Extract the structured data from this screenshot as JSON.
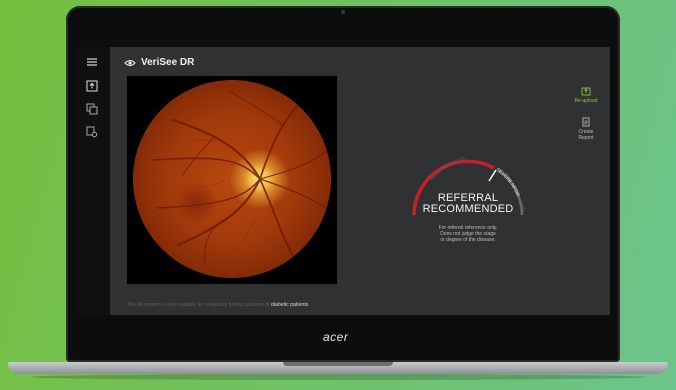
{
  "app": {
    "title": "VeriSee DR",
    "brand_logo": "acer"
  },
  "sidebar": {
    "items": [
      {
        "icon": "menu-icon"
      },
      {
        "icon": "upload-icon"
      },
      {
        "icon": "copy-icon"
      },
      {
        "icon": "report-settings-icon"
      }
    ]
  },
  "result": {
    "status_line1": "REFERRAL",
    "status_line2": "RECOMMENDED",
    "note_line1": "For referral reference only.",
    "note_line2": "Does not judge the stage",
    "note_line3": "or degree of the disease.",
    "gauge_labels": {
      "moderate": "MODERATE NPDR",
      "severe": "SEVERE NPDR",
      "pdr": "PDR"
    },
    "gauge_level": "severe",
    "colors": {
      "active": "#c8202a",
      "inactive": "#6a6c6e",
      "accent": "#8dc63f"
    }
  },
  "actions": {
    "reupload_label": "Re-upload",
    "create_report_line1": "Create",
    "create_report_line2": "Report"
  },
  "footer": {
    "disclaimer_prefix": "This AI system is only suitable for analyzing fundus pictures of",
    "disclaimer_highlight": "diabetic patients"
  }
}
